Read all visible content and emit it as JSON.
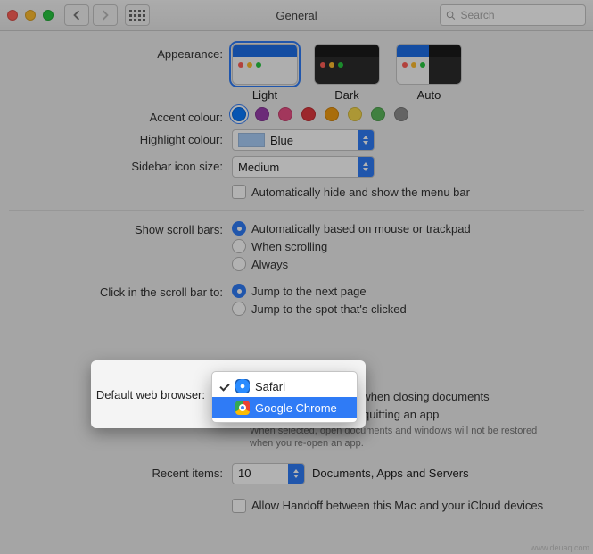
{
  "window": {
    "title": "General"
  },
  "search": {
    "placeholder": "Search"
  },
  "labels": {
    "appearance": "Appearance:",
    "accent": "Accent colour:",
    "highlight": "Highlight colour:",
    "sidebar": "Sidebar icon size:",
    "scrollbars": "Show scroll bars:",
    "clickscroll": "Click in the scroll bar to:",
    "defaultbrowser": "Default web browser:",
    "recent": "Recent items:"
  },
  "appearance": {
    "options": [
      "Light",
      "Dark",
      "Auto"
    ],
    "selected": "Light"
  },
  "accent_colors": [
    "#0a7aff",
    "#9a3ead",
    "#e94f84",
    "#e0383e",
    "#f39c12",
    "#f7d94c",
    "#5cb85c",
    "#8e8e8e"
  ],
  "accent_selected_index": 0,
  "highlight": {
    "value": "Blue"
  },
  "sidebar_size": {
    "value": "Medium"
  },
  "menubar_autohide": {
    "label": "Automatically hide and show the menu bar",
    "checked": false
  },
  "scrollbars": {
    "options": [
      "Automatically based on mouse or trackpad",
      "When scrolling",
      "Always"
    ],
    "selected_index": 0
  },
  "clickscroll": {
    "options": [
      "Jump to the next page",
      "Jump to the spot that's clicked"
    ],
    "selected_index": 0
  },
  "default_browser": {
    "options": [
      "Safari",
      "Google Chrome"
    ],
    "current": "Safari",
    "highlighted": "Google Chrome"
  },
  "docs": {
    "ask_keep": {
      "label": "Ask to keep changes when closing documents",
      "checked": false
    },
    "close_windows": {
      "label": "Close windows when quitting an app",
      "checked": true,
      "note": "When selected, open documents and windows will not be restored when you re-open an app."
    }
  },
  "recent": {
    "value": "10",
    "suffix": "Documents, Apps and Servers"
  },
  "handoff": {
    "label": "Allow Handoff between this Mac and your iCloud devices",
    "checked": false
  },
  "watermark": "www.deuaq.com"
}
